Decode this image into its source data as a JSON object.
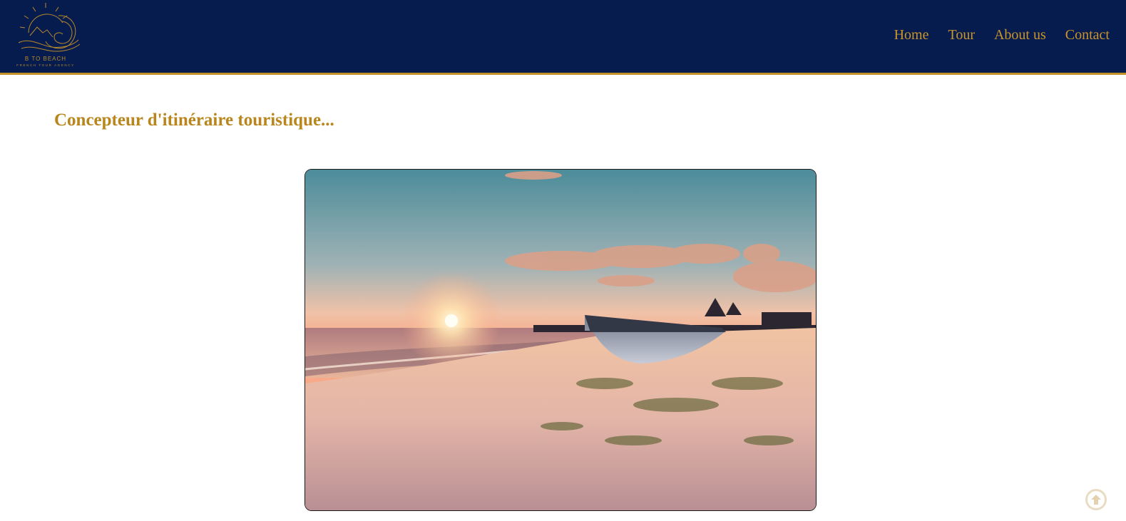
{
  "header": {
    "logo": {
      "name": "B TO BEACH",
      "tagline": "FRENCH TOUR AGENCY",
      "icon": "sun-wave-logo"
    },
    "nav": [
      {
        "label": "Home"
      },
      {
        "label": "Tour"
      },
      {
        "label": "About us"
      },
      {
        "label": "Contact"
      }
    ]
  },
  "main": {
    "title": "Concepteur d'itinéraire touristique...",
    "hero_image": "beach-sunset-boat-photo"
  },
  "scroll_top": {
    "icon": "arrow-up-circle-icon"
  },
  "colors": {
    "header_bg": "#071c4e",
    "accent_gold": "#c19325",
    "title_gold": "#b8861c"
  }
}
